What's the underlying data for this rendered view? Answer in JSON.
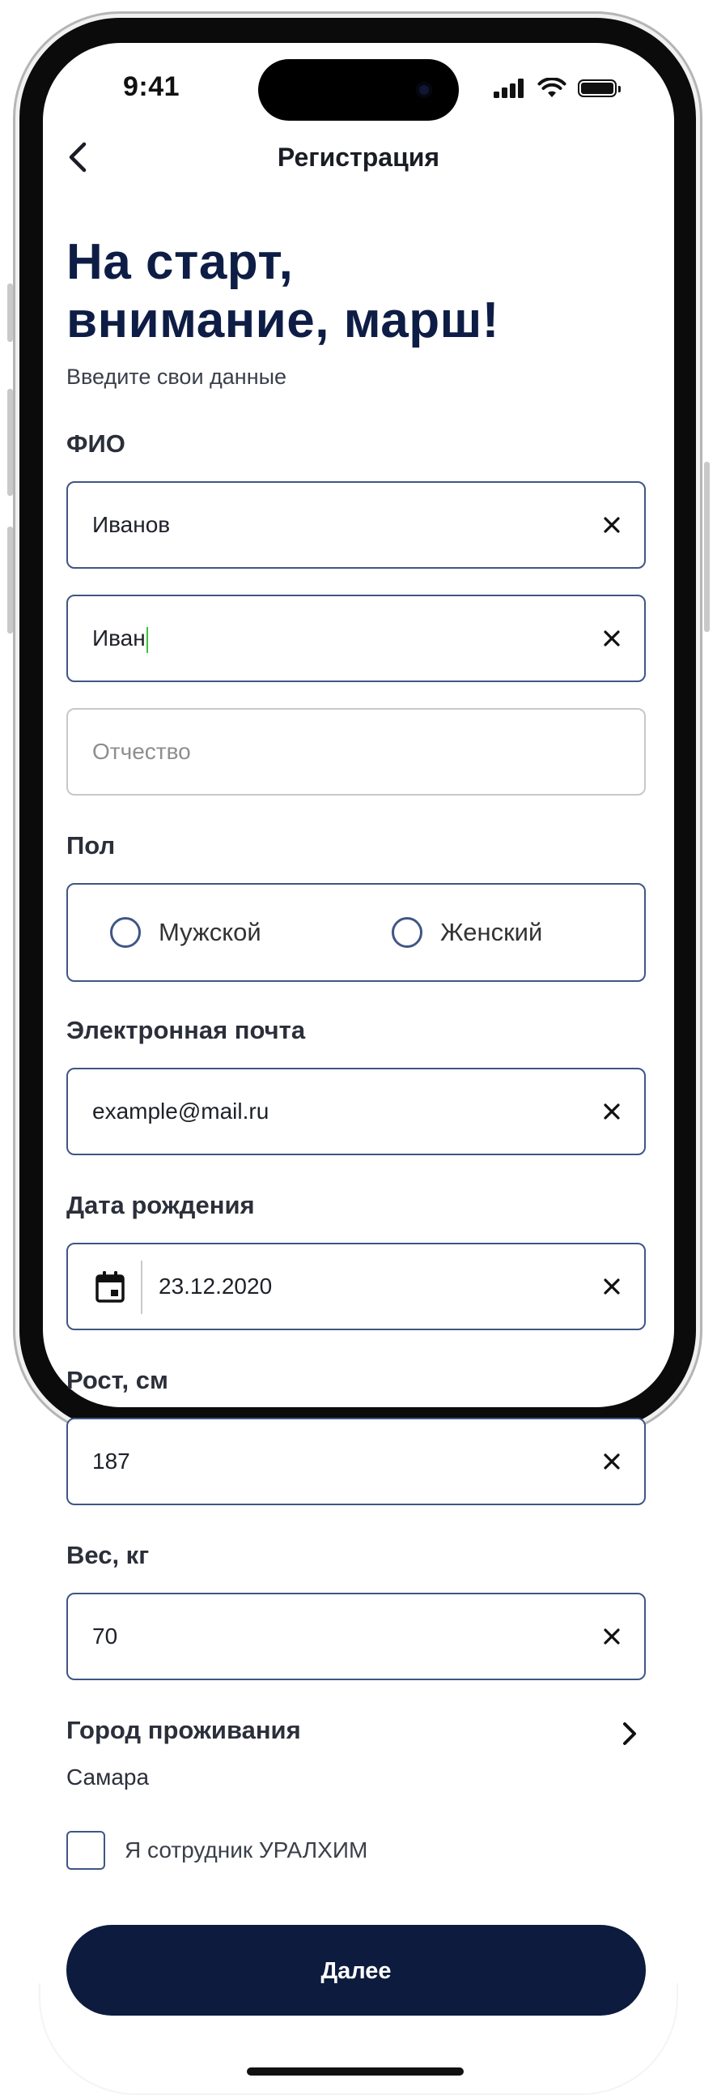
{
  "status_bar": {
    "time": "9:41"
  },
  "nav": {
    "title": "Регистрация"
  },
  "headline": "На старт,\nвнимание, марш!",
  "subtitle": "Введите свои данные",
  "fio": {
    "label": "ФИО",
    "last_name": "Иванов",
    "first_name": "Иван",
    "middle_name_placeholder": "Отчество"
  },
  "gender": {
    "label": "Пол",
    "options": [
      "Мужской",
      "Женский"
    ]
  },
  "email": {
    "label": "Электронная почта",
    "value": "example@mail.ru"
  },
  "birth_date": {
    "label": "Дата рождения",
    "value": "23.12.2020"
  },
  "height": {
    "label": "Рост, см",
    "value": "187"
  },
  "weight": {
    "label": "Вес, кг",
    "value": "70"
  },
  "city": {
    "label": "Город проживания",
    "value": "Самара"
  },
  "employee": {
    "label": "Я сотрудник УРАЛХИМ"
  },
  "next_button": {
    "label": "Далее"
  },
  "colors": {
    "primary_dark": "#0c1b3e",
    "headline": "#0e1d45",
    "field_border": "#3f5685",
    "caret": "#39c43a"
  },
  "icons": [
    "back-icon",
    "close-icon",
    "calendar-icon",
    "chevron-right-icon",
    "signal-icon",
    "wifi-icon",
    "battery-icon"
  ]
}
